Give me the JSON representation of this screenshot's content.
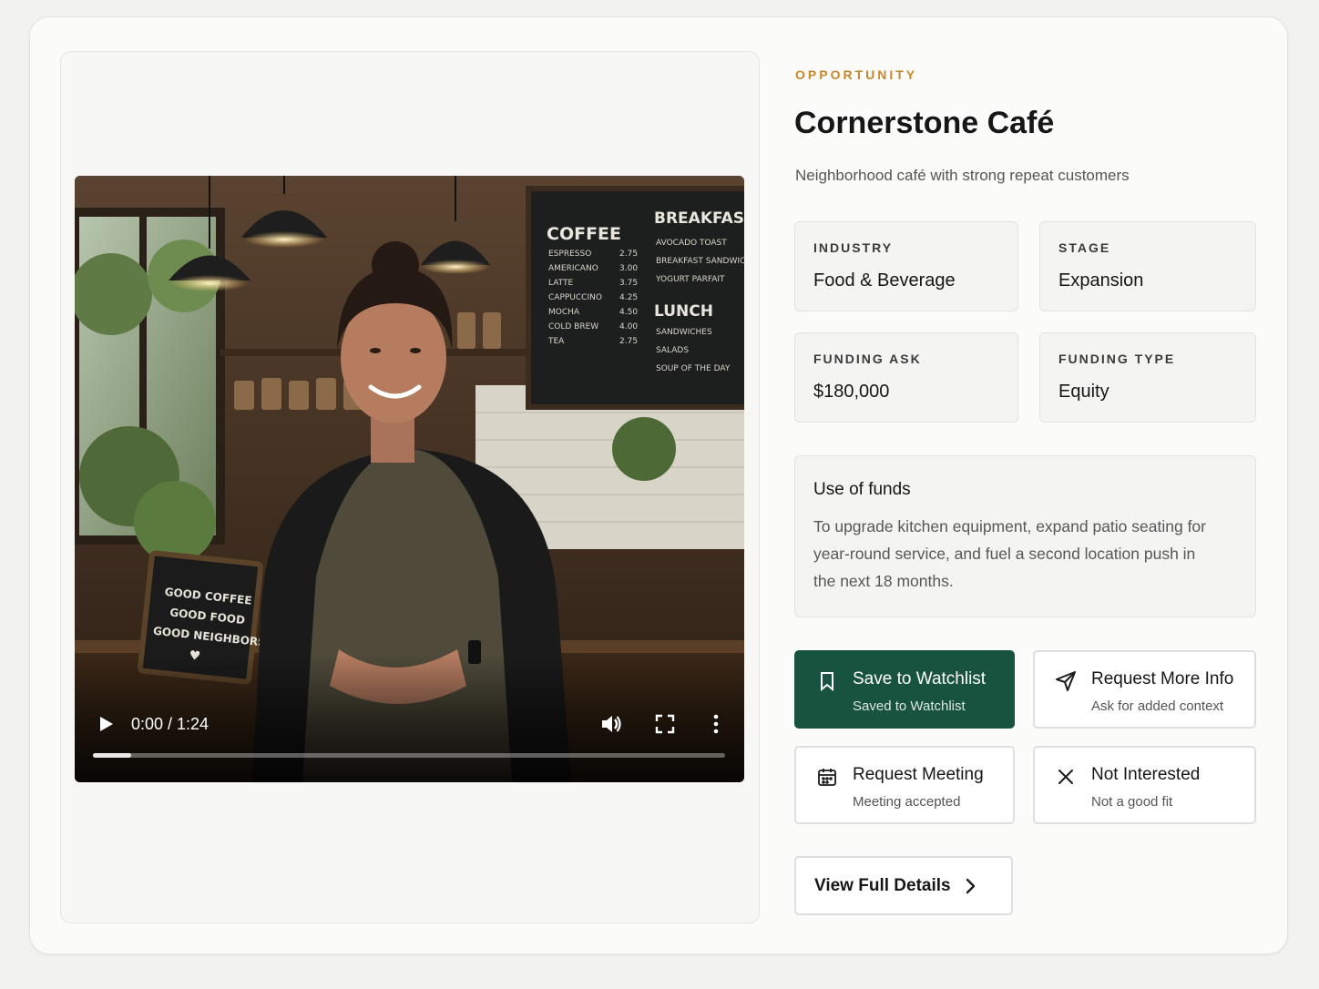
{
  "opportunity": {
    "eyebrow": "OPPORTUNITY",
    "name": "Cornerstone Café",
    "tagline": "Neighborhood café with strong repeat customers"
  },
  "video": {
    "time": "0:00 / 1:24",
    "progress": 0.06,
    "sign_lines": [
      "GOOD COFFEE",
      "GOOD FOOD",
      "GOOD NEIGHBORS"
    ],
    "menu_board": {
      "coffee_title": "COFFEE",
      "coffee_items": [
        "ESPRESSO",
        "AMERICANO",
        "LATTE",
        "CAPPUCCINO",
        "MOCHA",
        "COLD BREW",
        "TEA"
      ],
      "coffee_prices": [
        "2.75",
        "3.00",
        "3.75",
        "4.25",
        "4.50",
        "4.00",
        "2.75"
      ],
      "breakfast_title": "BREAKFAST",
      "breakfast_items": [
        "AVOCADO TOAST",
        "BREAKFAST SANDWICH",
        "YOGURT PARFAIT"
      ],
      "lunch_title": "LUNCH",
      "lunch_items": [
        "SANDWICHES",
        "SALADS",
        "SOUP OF THE DAY"
      ]
    }
  },
  "meta": {
    "industry_label": "INDUSTRY",
    "industry_value": "Food & Beverage",
    "stage_label": "STAGE",
    "stage_value": "Expansion",
    "funding_ask_label": "FUNDING ASK",
    "funding_ask_value": "$180,000",
    "funding_type_label": "FUNDING TYPE",
    "funding_type_value": "Equity"
  },
  "funds": {
    "heading": "Use of funds",
    "body": "To upgrade kitchen equipment, expand patio seating for year-round service, and fuel a second location push in the next 18 months."
  },
  "actions": {
    "watchlist_title": "Save to Watchlist",
    "watchlist_sub": "Saved to Watchlist",
    "info_title": "Request More Info",
    "info_sub": "Ask for added context",
    "meeting_title": "Request Meeting",
    "meeting_sub": "Meeting accepted",
    "not_interested_title": "Not Interested",
    "not_interested_sub": "Not a good fit",
    "details_label": "View Full Details"
  },
  "colors": {
    "accent_gold": "#c8882a",
    "primary_green": "#185340"
  },
  "icons": [
    "play-icon",
    "volume-icon",
    "fullscreen-icon",
    "more-vertical-icon",
    "bookmark-icon",
    "send-icon",
    "calendar-icon",
    "close-icon",
    "chevron-right-icon"
  ]
}
